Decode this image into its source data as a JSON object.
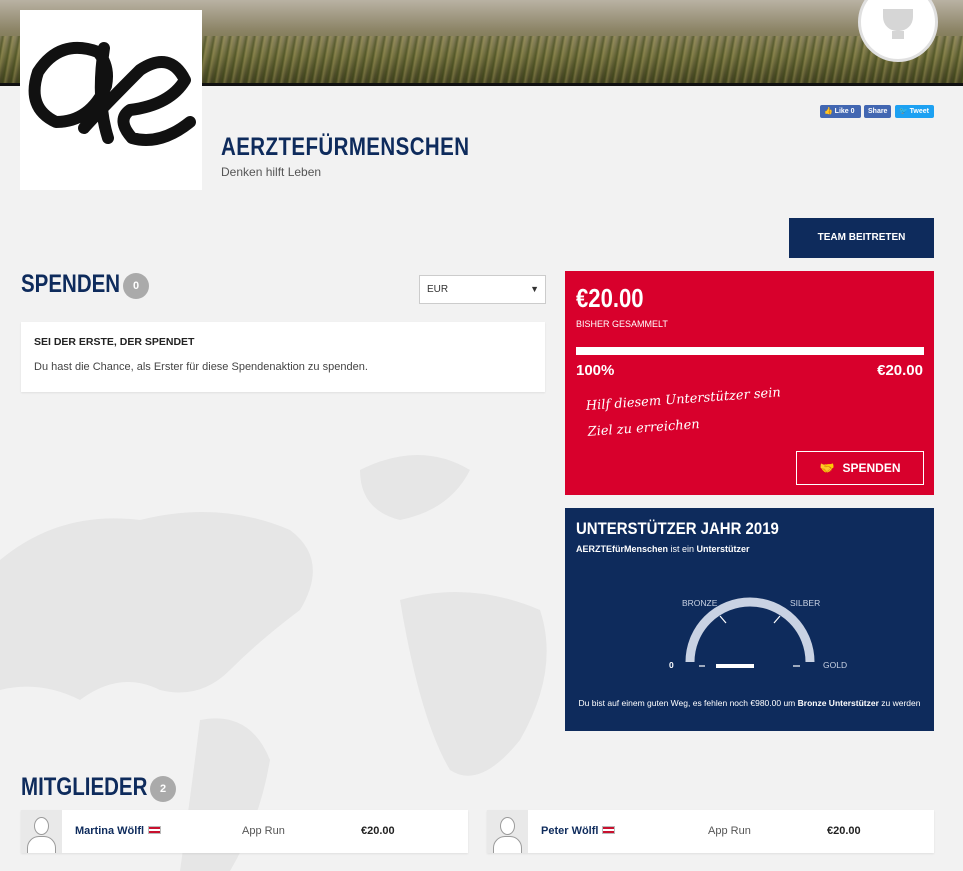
{
  "social": {
    "like": "Like 0",
    "share": "Share",
    "tweet": "Tweet"
  },
  "team": {
    "name": "AERZTEFÜRMENSCHEN",
    "tagline": "Denken hilft Leben",
    "logo_text": "ae"
  },
  "join_button": "TEAM BEITRETEN",
  "donations": {
    "title": "SPENDEN",
    "count": "0",
    "currency_selected": "EUR",
    "empty_heading": "SEI DER ERSTE, DER SPENDET",
    "empty_text": "Du hast die Chance, als Erster für diese Spendenaktion zu spenden."
  },
  "fundraising": {
    "amount": "€20.00",
    "raised_label": "BISHER GESAMMELT",
    "progress_fraction": 1.0,
    "percent": "100%",
    "goal": "€20.00",
    "handwritten_line1": "Hilf diesem Unterstützer sein",
    "handwritten_line2": "Ziel zu erreichen",
    "donate_label": "SPENDEN",
    "accent_color": "#d8002c"
  },
  "supporter": {
    "title": "UNTERSTÜTZER JAHR 2019",
    "subtitle_name": "AERZTEfürMenschen",
    "subtitle_middle": " ist ein ",
    "subtitle_level": "Unterstützer",
    "gauge": {
      "bronze": "BRONZE",
      "silber": "SILBER",
      "zero": "0",
      "gold": "GOLD"
    },
    "note_start": "Du bist auf einem guten Weg, es fehlen noch €980.00 um ",
    "note_bold": "Bronze Unterstützer",
    "note_end": " zu werden",
    "color": "#0e2b5c"
  },
  "members": {
    "title": "MITGLIEDER",
    "count": "2",
    "items": [
      {
        "name": "Martina Wölfl",
        "event": "App Run",
        "amount": "€20.00"
      },
      {
        "name": "Peter Wölfl",
        "event": "App Run",
        "amount": "€20.00"
      }
    ]
  }
}
